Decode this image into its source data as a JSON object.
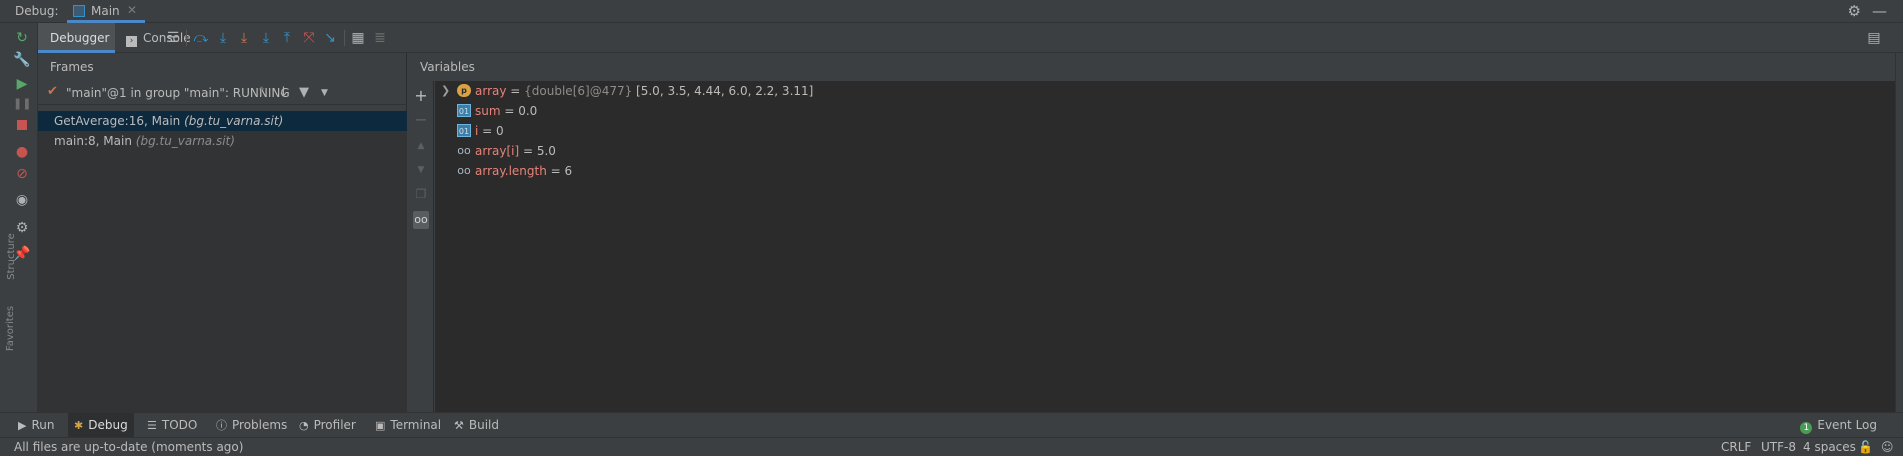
{
  "titlebar": {
    "label": "Debug:",
    "tab_label": "Main",
    "settings_icon": "gear-icon",
    "minimize_icon": "minimize-icon"
  },
  "toolbar": {
    "debugger_tab": "Debugger",
    "console_tab": "Console"
  },
  "frames": {
    "header": "Frames",
    "thread_text": "\"main\"@1 in group \"main\": RUNNING",
    "items": [
      {
        "method": "GetAverage:16, Main",
        "package": "(bg.tu_varna.sit)",
        "selected": true
      },
      {
        "method": "main:8, Main",
        "package": "(bg.tu_varna.sit)",
        "selected": false
      }
    ]
  },
  "variables": {
    "header": "Variables",
    "items": [
      {
        "icon": "p",
        "name": "array",
        "eq": " = ",
        "type": "{double[6]@477}",
        "value": " [5.0, 3.5, 4.44, 6.0, 2.2, 3.11]",
        "expandable": true
      },
      {
        "icon": "01",
        "name": "sum",
        "eq": " = ",
        "type": "",
        "value": "0.0",
        "expandable": false
      },
      {
        "icon": "01",
        "name": "i",
        "eq": " = ",
        "type": "",
        "value": "0",
        "expandable": false
      },
      {
        "icon": "oo",
        "name": "array[i]",
        "eq": " = ",
        "type": "",
        "value": "5.0",
        "expandable": false
      },
      {
        "icon": "oo",
        "name": "array.length",
        "eq": " = ",
        "type": "",
        "value": "6",
        "expandable": false
      }
    ]
  },
  "bottom_tabs": [
    {
      "label": "Run",
      "icon": "play-icon",
      "active": false
    },
    {
      "label": "Debug",
      "icon": "bug-icon",
      "active": true
    },
    {
      "label": "TODO",
      "icon": "list-icon",
      "active": false
    },
    {
      "label": "Problems",
      "icon": "info-icon",
      "active": false
    },
    {
      "label": "Profiler",
      "icon": "profiler-icon",
      "active": false
    },
    {
      "label": "Terminal",
      "icon": "terminal-icon",
      "active": false
    },
    {
      "label": "Build",
      "icon": "hammer-icon",
      "active": false
    }
  ],
  "event_log": {
    "label": "Event Log",
    "count": "1"
  },
  "statusbar": {
    "message": "All files are up-to-date (moments ago)",
    "line_separator": "CRLF",
    "encoding": "UTF-8",
    "indent": "4 spaces"
  },
  "colors": {
    "accent": "#4a88c7",
    "selection": "#0d293e",
    "var_name": "#e5837a",
    "green": "#499c54",
    "red": "#c75450"
  },
  "side_labels": {
    "structure": "Structure",
    "favorites": "Favorites"
  }
}
